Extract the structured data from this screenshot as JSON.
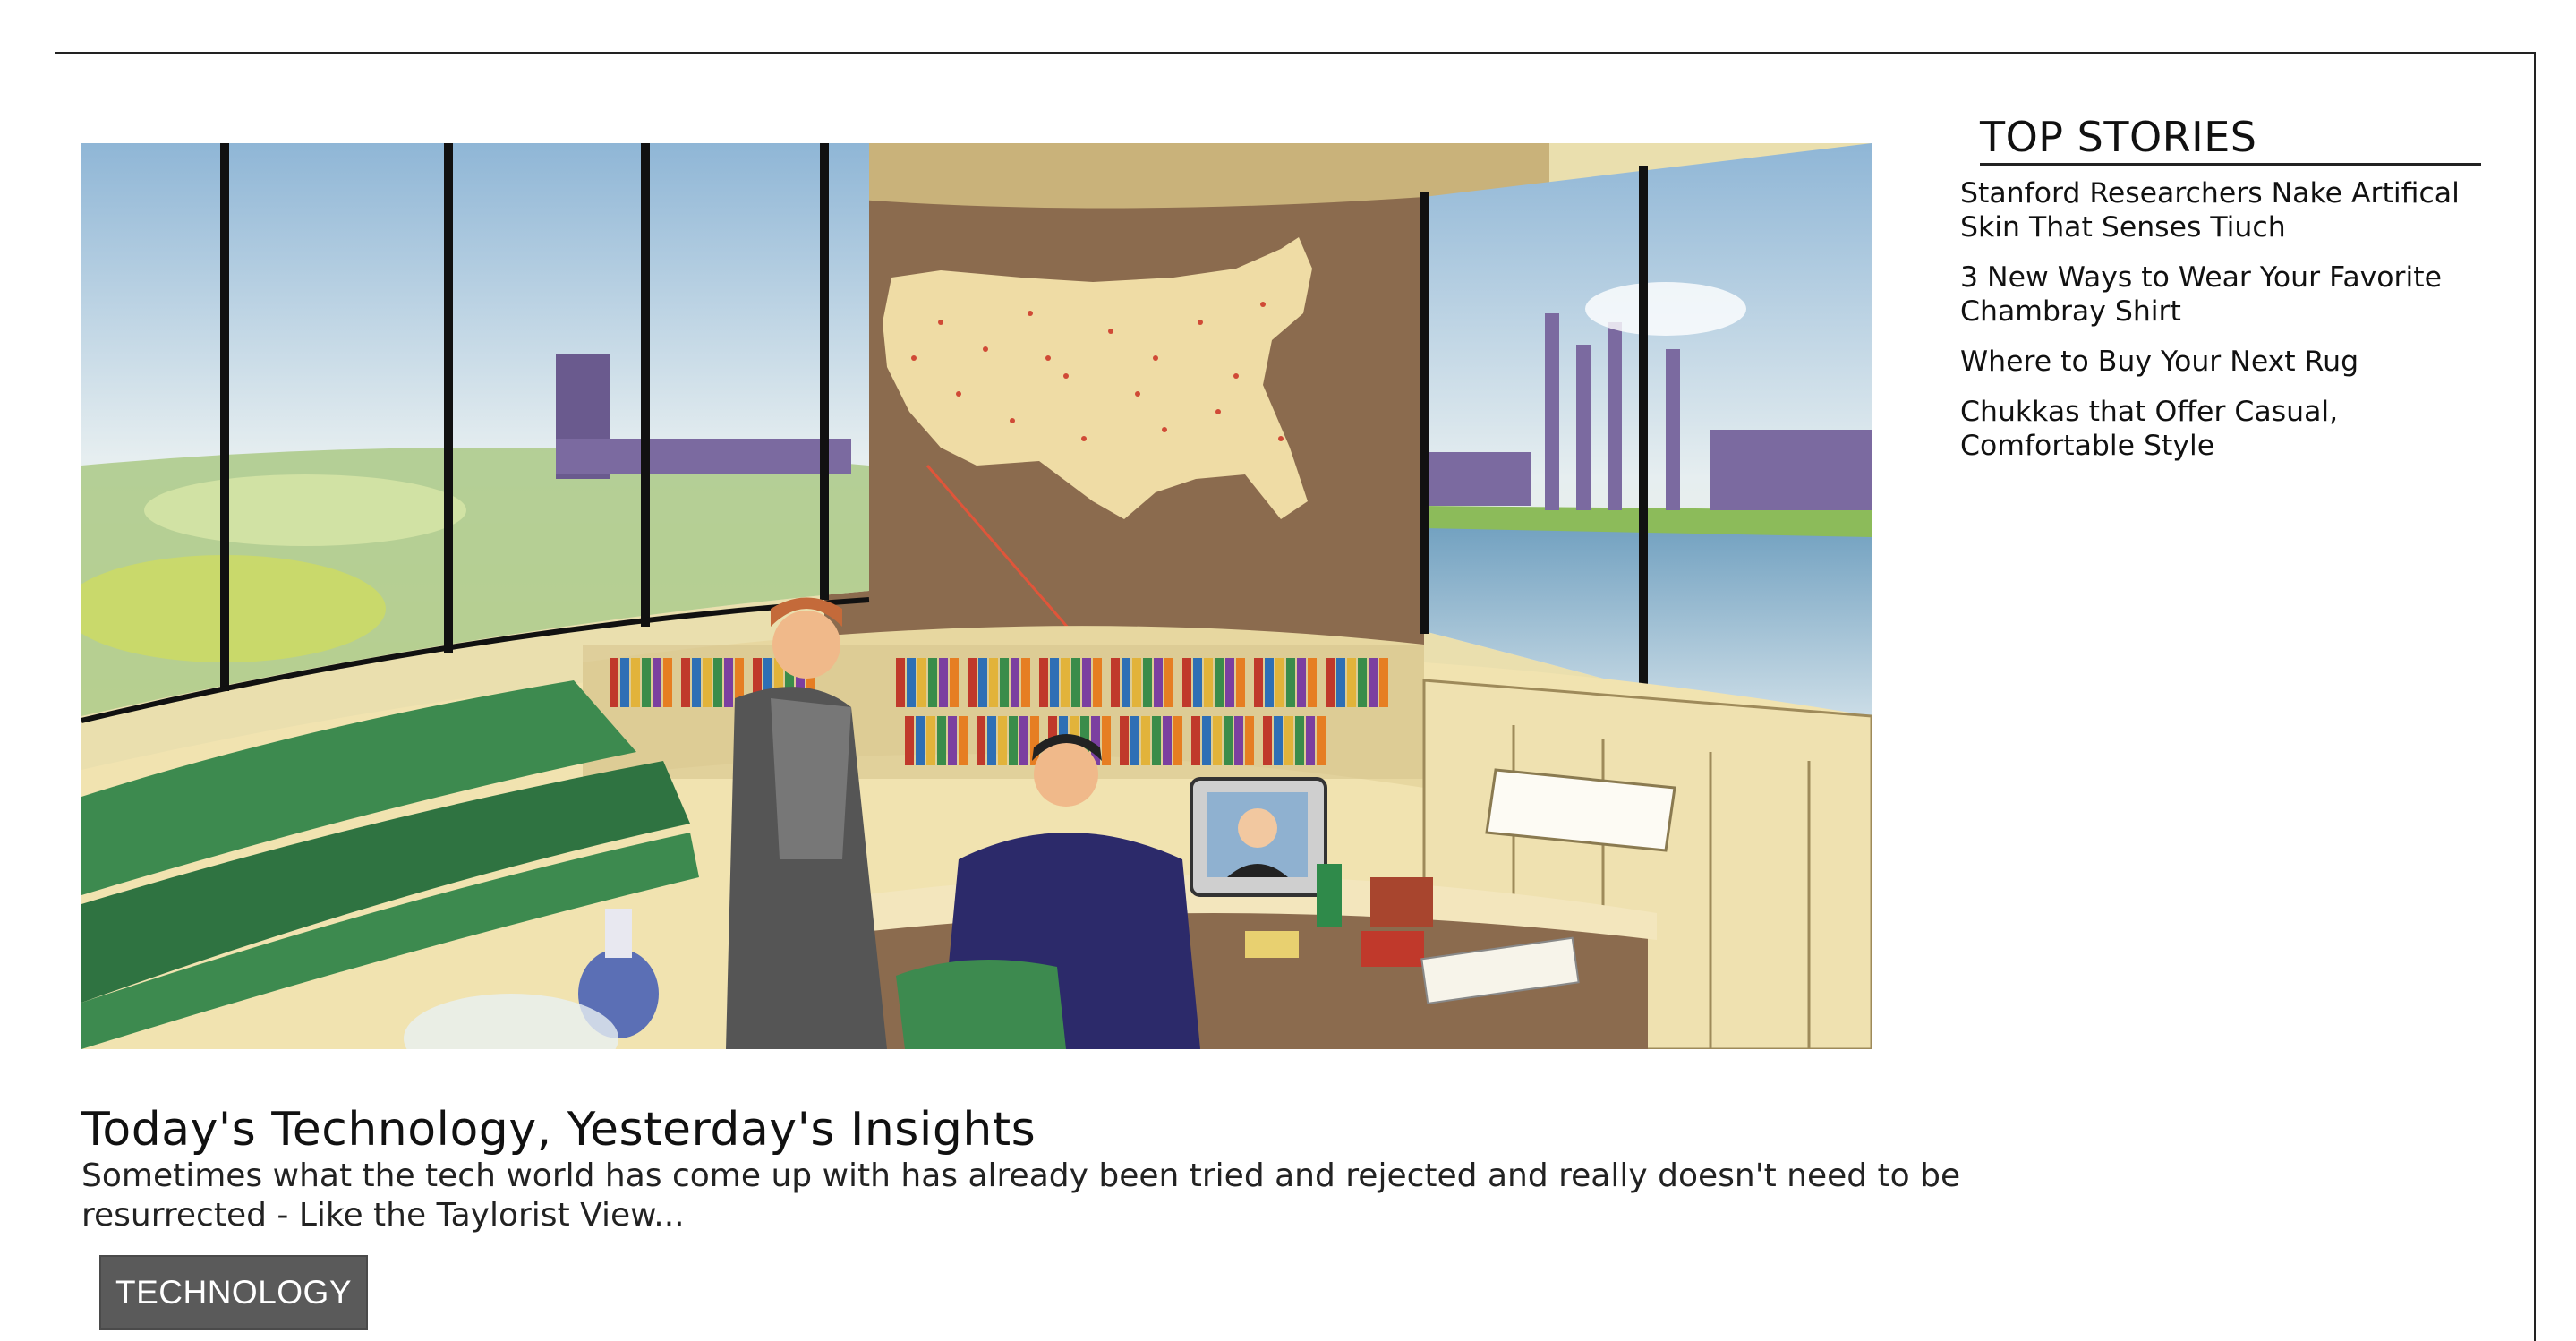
{
  "article": {
    "headline": "Today's Technology, Yesterday's Insights",
    "summary": "Sometimes what the tech world has come up with has already been tried and rejected and really doesn't need to be resurrected - Like the Taylorist View...",
    "category_label": "TECHNOLOGY"
  },
  "sidebar": {
    "title": "TOP STORIES",
    "stories": [
      {
        "label": "Stanford Researchers Nake Artifical Skin That Senses Tiuch"
      },
      {
        "label": "3 New Ways to Wear Your Favorite Chambray Shirt"
      },
      {
        "label": "Where to Buy Your Next Rug"
      },
      {
        "label": "Chukkas that Offer Casual, Comfortable Style"
      }
    ]
  },
  "colors": {
    "button_bg": "#5a5a5a",
    "text": "#111111",
    "border": "#222222"
  }
}
